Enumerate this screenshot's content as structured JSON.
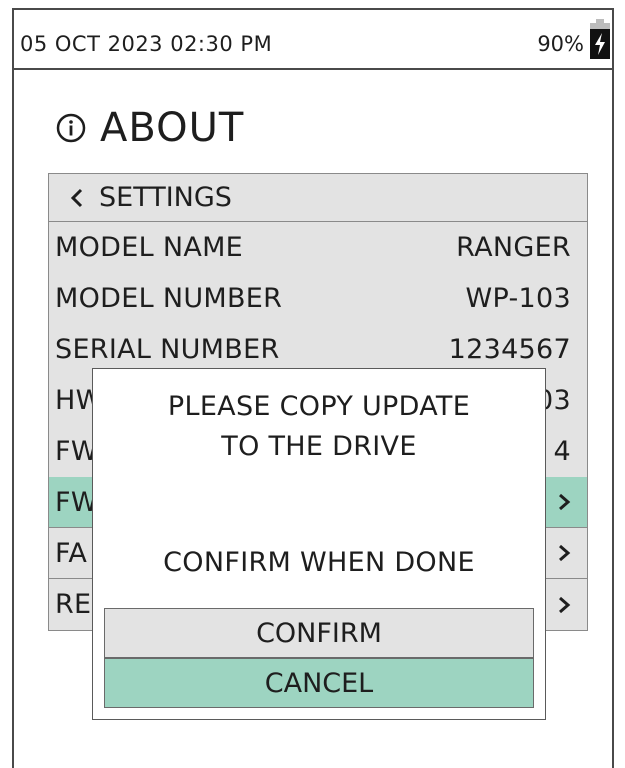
{
  "status_bar": {
    "datetime": "05 OCT 2023 02:30 PM",
    "battery_percent": "90%",
    "battery_icon": "battery-charging-icon"
  },
  "page": {
    "title": "ABOUT",
    "icon": "info-icon"
  },
  "menu": {
    "back_label": "SETTINGS",
    "rows": [
      {
        "label": "MODEL NAME",
        "value": "RANGER"
      },
      {
        "label": "MODEL NUMBER",
        "value": "WP-103"
      },
      {
        "label": "SERIAL NUMBER",
        "value": "1234567"
      },
      {
        "label": "HW",
        "value": "03"
      },
      {
        "label": "FW",
        "value": "4"
      }
    ],
    "links": [
      {
        "label": "FW",
        "active": true
      },
      {
        "label": "FA",
        "active": false
      },
      {
        "label": "RE",
        "active": false
      }
    ]
  },
  "dialog": {
    "line1": "PLEASE COPY UPDATE",
    "line2": "TO THE DRIVE",
    "line3": "CONFIRM WHEN DONE",
    "confirm_label": "CONFIRM",
    "cancel_label": "CANCEL"
  },
  "colors": {
    "accent": "#9dd4c1",
    "panel": "#e3e3e3",
    "border": "#4a4a4a"
  }
}
